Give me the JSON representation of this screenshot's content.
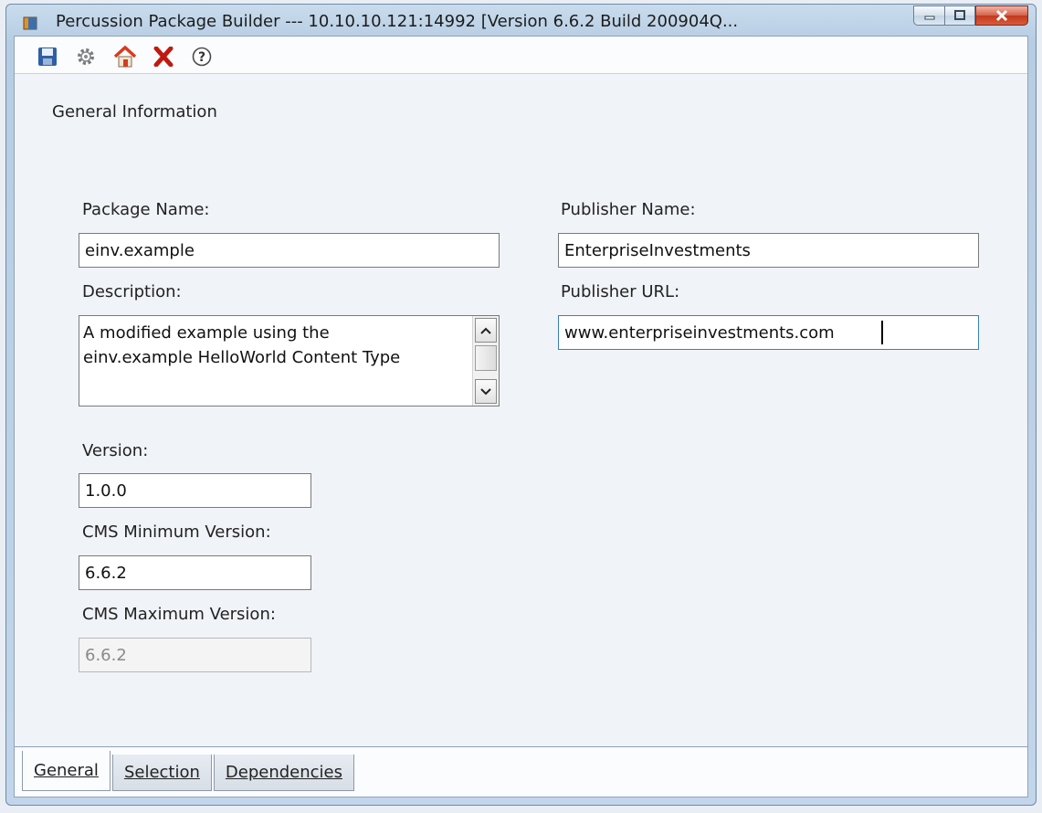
{
  "window": {
    "title": "Percussion Package Builder --- 10.10.10.121:14992 [Version 6.6.2  Build 200904Q..."
  },
  "toolbar": {
    "icons": [
      "save-icon",
      "gear-icon",
      "home-icon",
      "close-x-icon",
      "help-icon"
    ]
  },
  "form": {
    "section_title": "General Information",
    "package_name_label": "Package Name:",
    "package_name_value": "einv.example",
    "description_label": "Description:",
    "description_value": "A modified example using the\neinv.example HelloWorld Content Type",
    "publisher_name_label": "Publisher Name:",
    "publisher_name_value": "EnterpriseInvestments",
    "publisher_url_label": "Publisher URL:",
    "publisher_url_value": "www.enterpriseinvestments.com",
    "version_label": "Version:",
    "version_value": "1.0.0",
    "cms_min_label": "CMS Minimum Version:",
    "cms_min_value": "6.6.2",
    "cms_max_label": "CMS Maximum Version:",
    "cms_max_value": "6.6.2"
  },
  "tabs": [
    {
      "label": "General"
    },
    {
      "label": "Selection"
    },
    {
      "label": "Dependencies"
    }
  ],
  "colors": {
    "close_button": "#c2391f",
    "home_roof": "#d83a1e",
    "x_icon": "#c01a10"
  }
}
